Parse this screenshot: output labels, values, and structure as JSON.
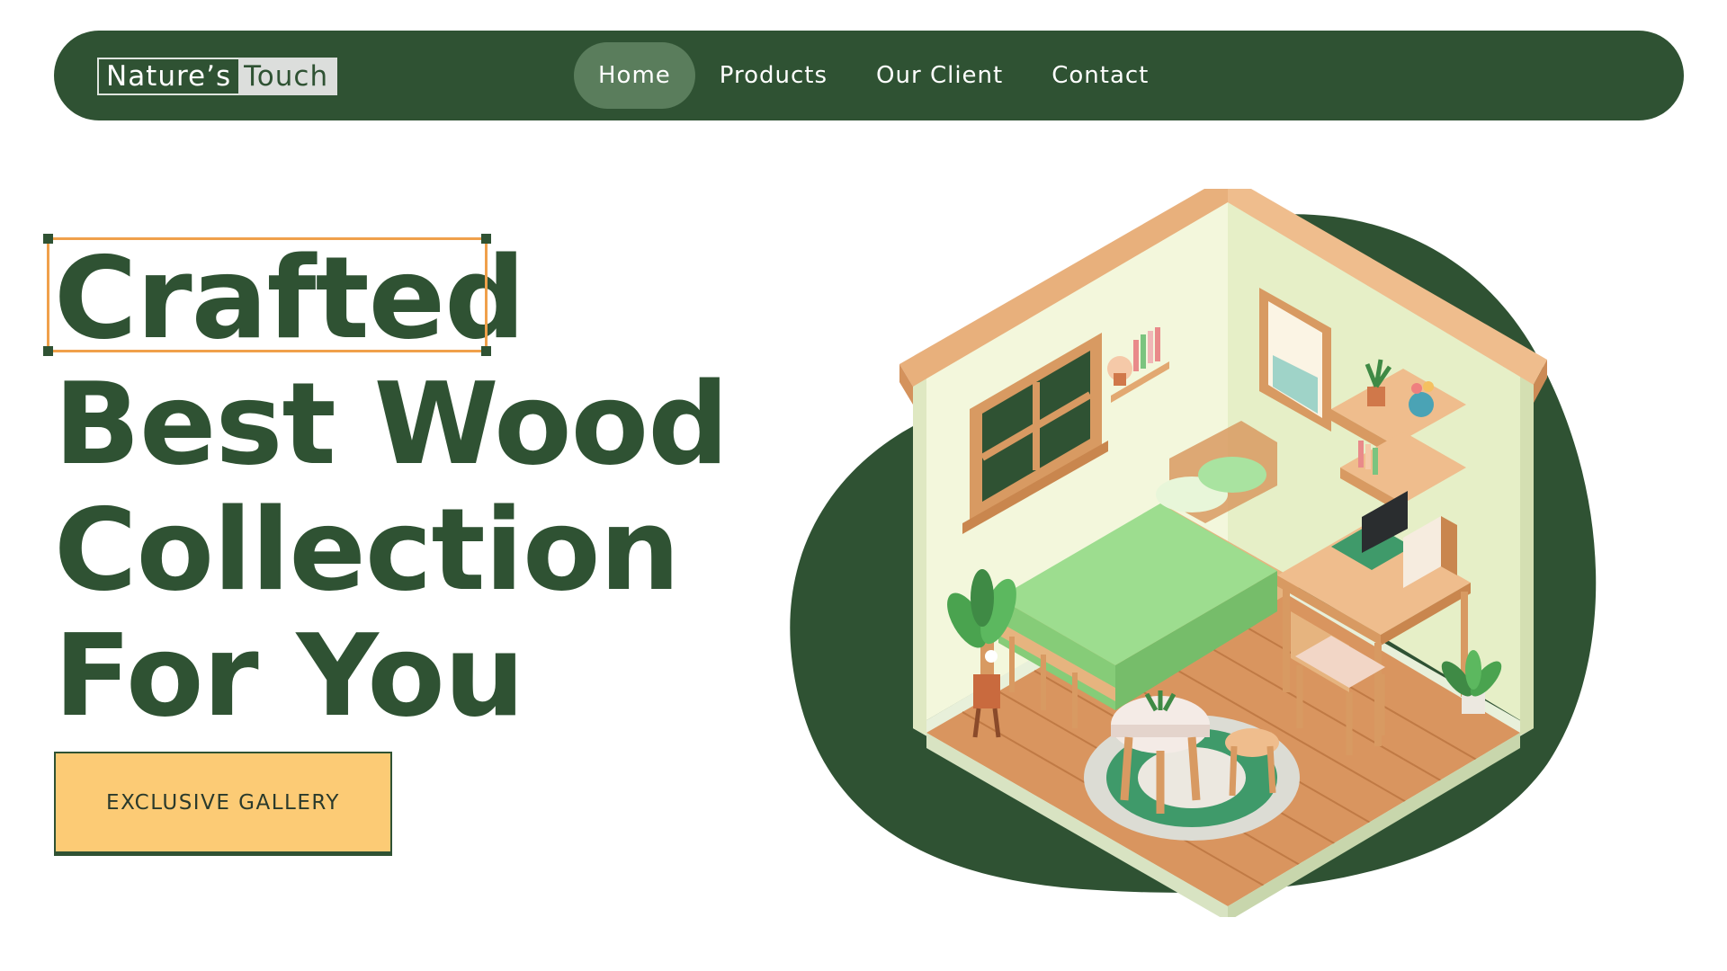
{
  "brand": {
    "part1": "Nature’s",
    "part2": "Touch"
  },
  "nav": {
    "items": [
      {
        "label": "Home",
        "active": true
      },
      {
        "label": "Products",
        "active": false
      },
      {
        "label": "Our Client",
        "active": false
      },
      {
        "label": "Contact",
        "active": false
      }
    ]
  },
  "hero": {
    "lines": [
      "Crafted",
      "Best Wood",
      "Collection",
      "For You"
    ],
    "cta_label": "EXCLUSIVE GALLERY"
  },
  "colors": {
    "primary": "#2f5233",
    "accent": "#fccb75",
    "selection": "#f0a04b"
  }
}
